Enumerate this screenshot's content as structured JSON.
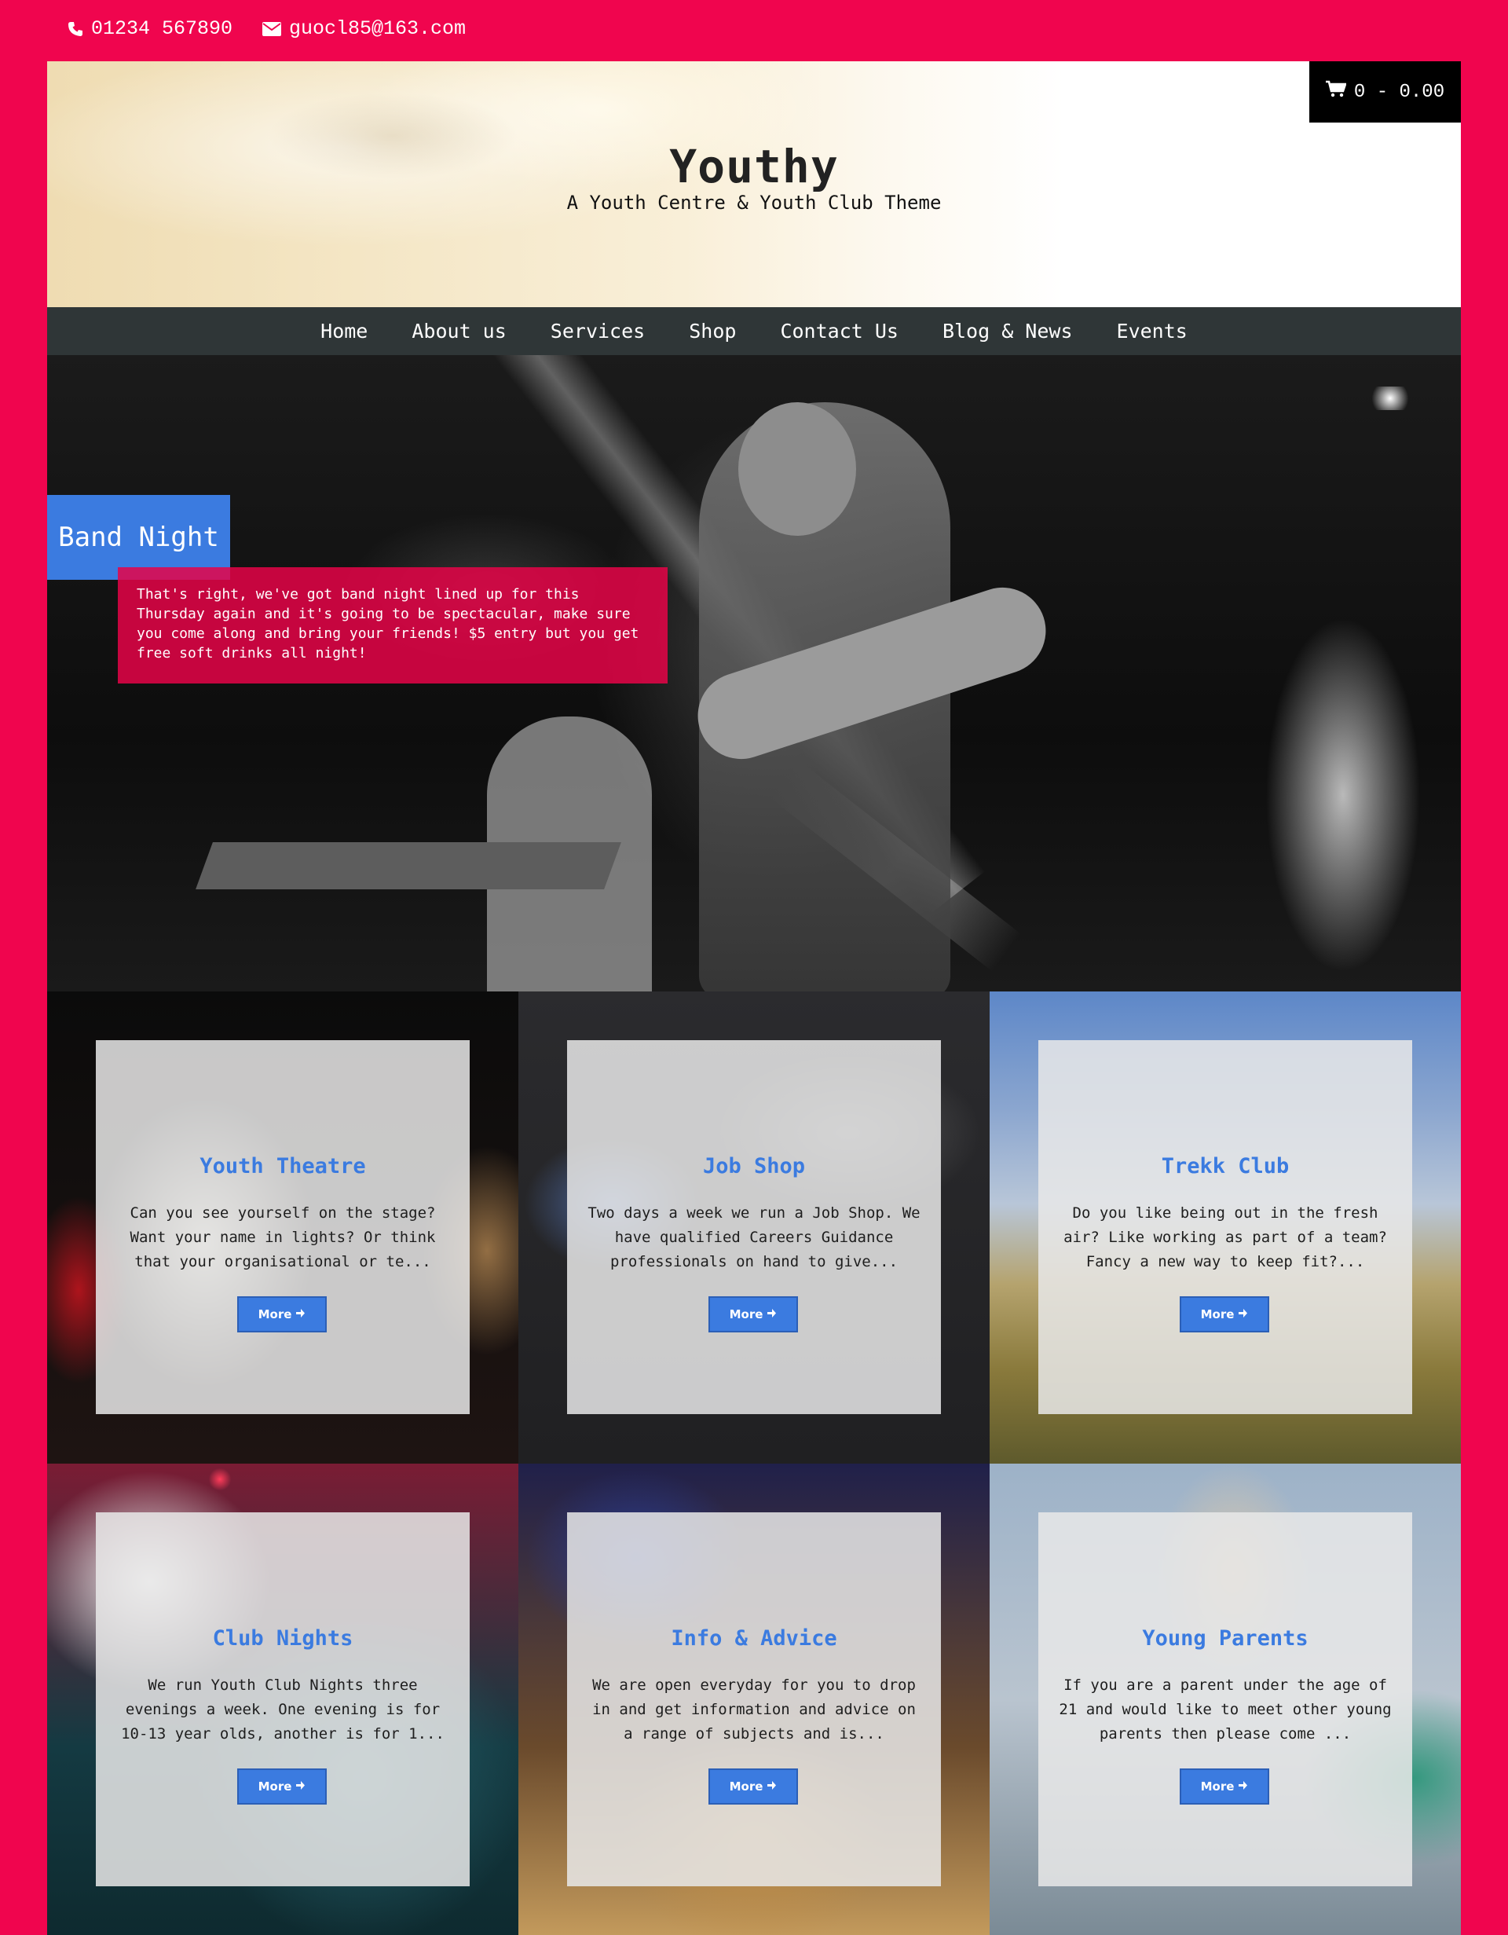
{
  "topbar": {
    "phone": "01234 567890",
    "email": "guocl85@163.com",
    "phone_icon": "phone-icon",
    "email_icon": "envelope-icon"
  },
  "cart": {
    "label": "0 - 0.00",
    "icon": "shopping-cart-icon"
  },
  "site": {
    "title": "Youthy",
    "tagline": "A Youth Centre & Youth Club Theme"
  },
  "nav": [
    "Home",
    "About us",
    "Services",
    "Shop",
    "Contact Us",
    "Blog & News",
    "Events"
  ],
  "hero": {
    "title": "Band Night",
    "text": "That's right, we've got band night lined up for this Thursday again and it's going to be spectacular, make sure you come along and bring your friends! $5 entry but you get free soft drinks all night!"
  },
  "tiles": [
    {
      "title": "Youth Theatre",
      "text": "Can you see yourself on the stage? Want your name in lights? Or think that your organisational or te...",
      "button": "More"
    },
    {
      "title": "Job Shop",
      "text": "Two days a week we run a Job Shop. We have qualified Careers Guidance professionals on hand to give...",
      "button": "More"
    },
    {
      "title": "Trekk Club",
      "text": "Do you like being out in the fresh air? Like working as part of a team? Fancy a new way to keep fit?...",
      "button": "More"
    },
    {
      "title": "Club Nights",
      "text": "We run Youth Club Nights three evenings a week. One evening is for 10-13 year olds, another is for 1...",
      "button": "More"
    },
    {
      "title": "Info & Advice",
      "text": "We are open everyday for you to drop in and get information and advice on a range of subjects and is...",
      "button": "More"
    },
    {
      "title": "Young Parents",
      "text": "If you are a parent under the age of 21 and would like to meet other young parents then please come ...",
      "button": "More"
    }
  ],
  "colors": {
    "brand_pink": "#f0054e",
    "accent_blue": "#3b7be0",
    "nav_bg": "#2f3637",
    "cart_bg": "#000000"
  }
}
